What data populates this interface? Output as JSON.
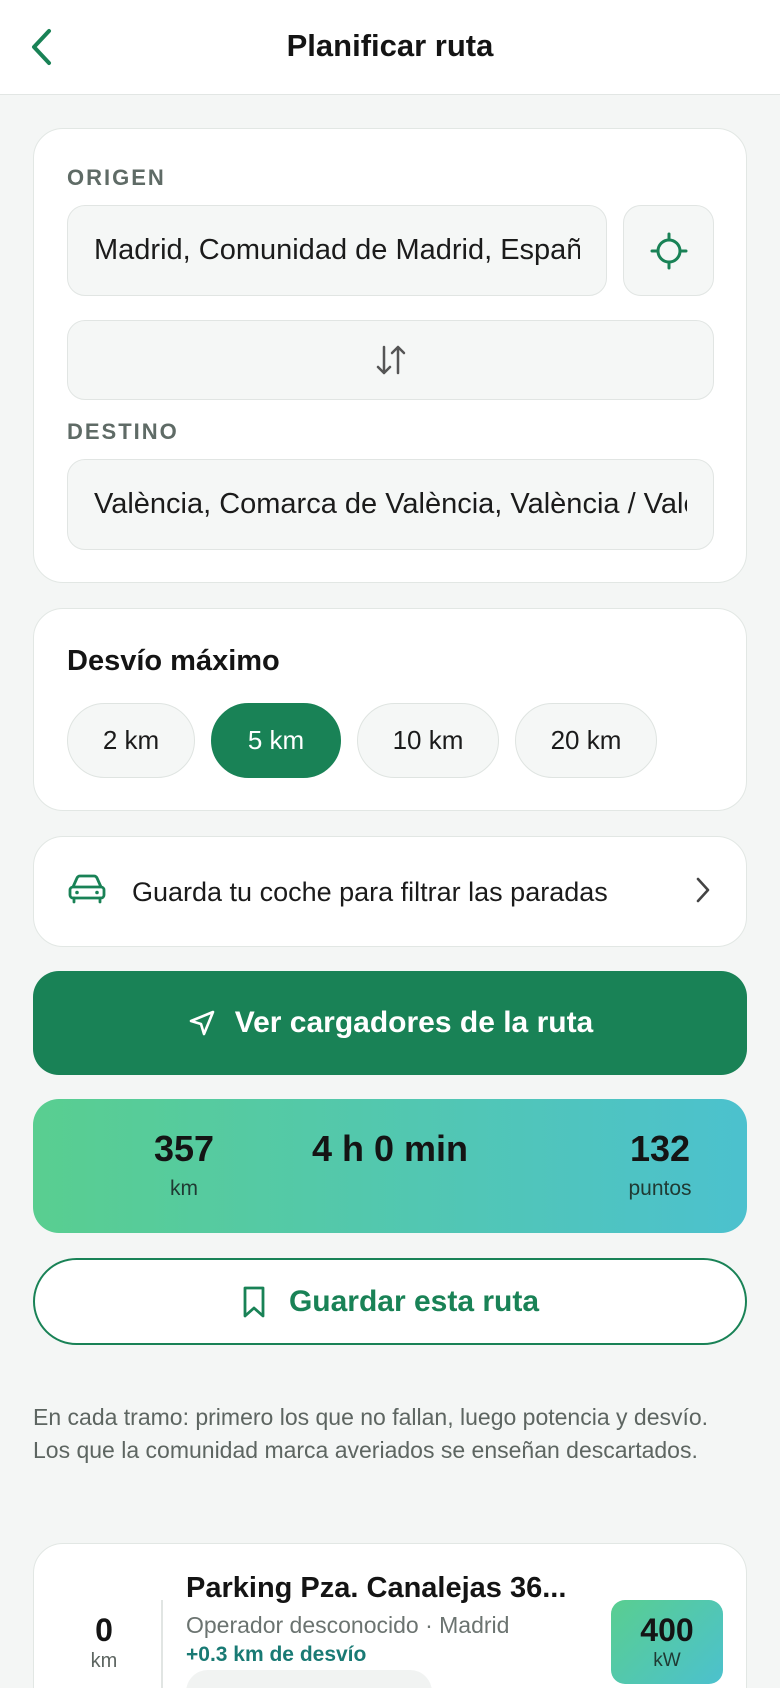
{
  "header": {
    "title": "Planificar ruta"
  },
  "route": {
    "origin_label": "ORIGEN",
    "origin_value": "Madrid, Comunidad de Madrid, España",
    "destination_label": "DESTINO",
    "destination_value": "València, Comarca de València, València / Valencia, España"
  },
  "detour": {
    "title": "Desvío máximo",
    "options": [
      "2 km",
      "5 km",
      "10 km",
      "20 km"
    ],
    "selected": "5 km"
  },
  "car_prompt": {
    "label": "Guarda tu coche para filtrar las paradas"
  },
  "cta": {
    "label": "Ver cargadores de la ruta"
  },
  "stats": {
    "distance_value": "357",
    "distance_unit": "km",
    "duration_value": "4 h 0 min",
    "points_value": "132",
    "points_unit": "puntos"
  },
  "save": {
    "label": "Guardar esta ruta"
  },
  "info": {
    "text": "En cada tramo: primero los que no fallan, luego potencia y desvío. Los que la comunidad marca averiados se enseñan descartados."
  },
  "station": {
    "distance_value": "0",
    "distance_unit": "km",
    "name": "Parking Pza. Canalejas 36...",
    "subtitle": "Operador desconocido · Madrid",
    "detour": "+0.3 km de desvío",
    "power_value": "400",
    "power_unit": "kW"
  },
  "colors": {
    "accent": "#198256",
    "gradient_start": "#59ce90",
    "gradient_end": "#4cc1ce"
  }
}
